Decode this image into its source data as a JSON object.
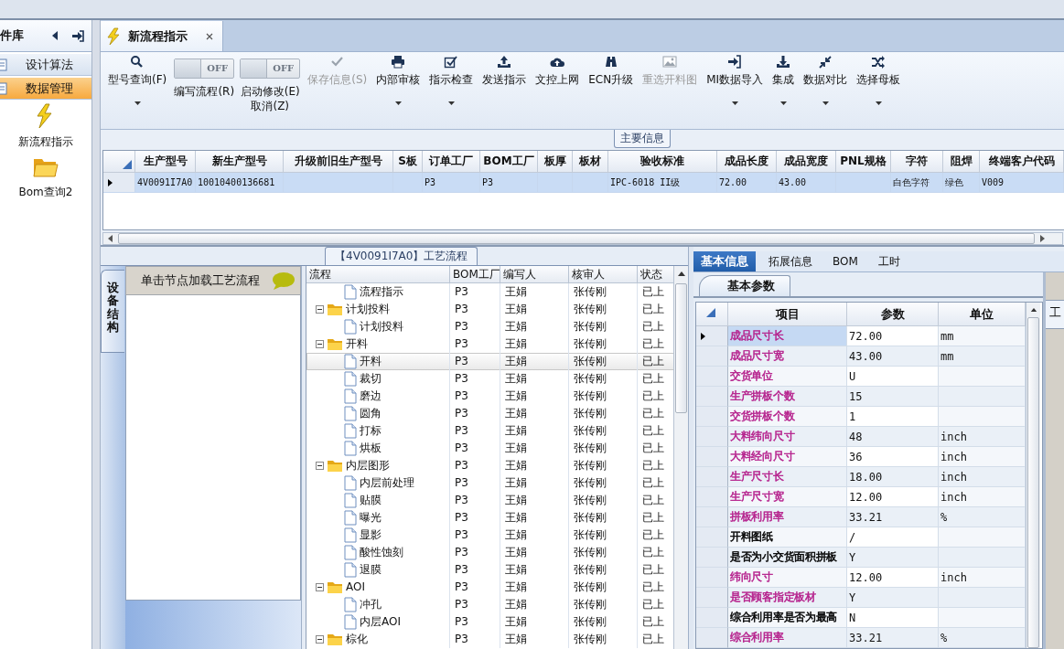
{
  "sidebar": {
    "title": "件库",
    "items": [
      {
        "label": "设计算法",
        "selected": false
      },
      {
        "label": "数据管理",
        "selected": true
      }
    ],
    "shortcuts": [
      {
        "label": "新流程指示"
      },
      {
        "label": "Bom查询2"
      }
    ]
  },
  "tabs": [
    {
      "label": "新流程指示",
      "selected": true,
      "closable": true
    }
  ],
  "toolbar": {
    "items": [
      {
        "kind": "button",
        "label": "型号查询(F)",
        "disabled": false,
        "dropdown": true
      },
      {
        "kind": "toggle",
        "label": "编写流程(R)",
        "on": false,
        "state_text": "OFF"
      },
      {
        "kind": "toggle",
        "label": "启动修改(E)",
        "on": false,
        "state_text": "OFF",
        "sublabel": "取消(Z)"
      },
      {
        "kind": "button",
        "label": "保存信息(S)",
        "disabled": true,
        "dropdown": false
      },
      {
        "kind": "button",
        "label": "内部审核",
        "disabled": false,
        "dropdown": true
      },
      {
        "kind": "button",
        "label": "指示检查",
        "disabled": false,
        "dropdown": true
      },
      {
        "kind": "button",
        "label": "发送指示",
        "disabled": false,
        "dropdown": false
      },
      {
        "kind": "button",
        "label": "文控上网",
        "disabled": false,
        "dropdown": false
      },
      {
        "kind": "button",
        "label": "ECN升级",
        "disabled": false,
        "dropdown": false
      },
      {
        "kind": "button",
        "label": "重选开料图",
        "disabled": true,
        "dropdown": false
      },
      {
        "kind": "button",
        "label": "MI数据导入",
        "disabled": false,
        "dropdown": true
      },
      {
        "kind": "button",
        "label": "集成",
        "disabled": false,
        "dropdown": true
      },
      {
        "kind": "button",
        "label": "数据对比",
        "disabled": false,
        "dropdown": true
      },
      {
        "kind": "button",
        "label": "选择母板",
        "disabled": false,
        "dropdown": true
      }
    ]
  },
  "main_info": {
    "title": "主要信息",
    "columns": [
      "生产型号",
      "新生产型号",
      "升级前旧生产型号",
      "S板",
      "订单工厂",
      "BOM工厂",
      "板厚",
      "板材",
      "验收标准",
      "成品长度",
      "成品宽度",
      "PNL规格",
      "字符",
      "阻焊",
      "终端客户代码"
    ],
    "rows": [
      {
        "selected": true,
        "cells": [
          "4V0091I7A0",
          "10010400136681",
          null,
          null,
          "P3",
          "P3",
          null,
          null,
          "IPC-6018 II级",
          "72.00",
          "43.00",
          null,
          "白色字符",
          "绿色",
          "V009"
        ]
      }
    ]
  },
  "process": {
    "title": "【4V0091I7A0】工艺流程",
    "side_tab": "设备结构",
    "hint": "单击节点加载工艺流程",
    "columns": [
      "流程",
      "BOM工厂",
      "编写人",
      "核审人",
      "状态"
    ],
    "rows": [
      {
        "kind": "step",
        "name": "流程指示",
        "bom": "P3",
        "writer": "王娟",
        "reviewer": "张传刚",
        "status": "已上",
        "selected": false
      },
      {
        "kind": "folder",
        "name": "计划投料",
        "bom": "P3",
        "writer": "王娟",
        "reviewer": "张传刚",
        "status": "已上",
        "selected": false,
        "expanded": true,
        "children": [
          {
            "kind": "step",
            "name": "计划投料",
            "bom": "P3",
            "writer": "王娟",
            "reviewer": "张传刚",
            "status": "已上",
            "selected": false
          }
        ]
      },
      {
        "kind": "folder",
        "name": "开料",
        "bom": "P3",
        "writer": "王娟",
        "reviewer": "张传刚",
        "status": "已上",
        "selected": false,
        "expanded": true,
        "children": [
          {
            "kind": "step",
            "name": "开料",
            "bom": "P3",
            "writer": "王娟",
            "reviewer": "张传刚",
            "status": "已上",
            "selected": true
          },
          {
            "kind": "step",
            "name": "裁切",
            "bom": "P3",
            "writer": "王娟",
            "reviewer": "张传刚",
            "status": "已上",
            "selected": false
          },
          {
            "kind": "step",
            "name": "磨边",
            "bom": "P3",
            "writer": "王娟",
            "reviewer": "张传刚",
            "status": "已上",
            "selected": false
          },
          {
            "kind": "step",
            "name": "圆角",
            "bom": "P3",
            "writer": "王娟",
            "reviewer": "张传刚",
            "status": "已上",
            "selected": false
          },
          {
            "kind": "step",
            "name": "打标",
            "bom": "P3",
            "writer": "王娟",
            "reviewer": "张传刚",
            "status": "已上",
            "selected": false
          },
          {
            "kind": "step",
            "name": "烘板",
            "bom": "P3",
            "writer": "王娟",
            "reviewer": "张传刚",
            "status": "已上",
            "selected": false
          }
        ]
      },
      {
        "kind": "folder",
        "name": "内层图形",
        "bom": "P3",
        "writer": "王娟",
        "reviewer": "张传刚",
        "status": "已上",
        "selected": false,
        "expanded": true,
        "children": [
          {
            "kind": "step",
            "name": "内层前处理",
            "bom": "P3",
            "writer": "王娟",
            "reviewer": "张传刚",
            "status": "已上",
            "selected": false
          },
          {
            "kind": "step",
            "name": "贴膜",
            "bom": "P3",
            "writer": "王娟",
            "reviewer": "张传刚",
            "status": "已上",
            "selected": false
          },
          {
            "kind": "step",
            "name": "曝光",
            "bom": "P3",
            "writer": "王娟",
            "reviewer": "张传刚",
            "status": "已上",
            "selected": false
          },
          {
            "kind": "step",
            "name": "显影",
            "bom": "P3",
            "writer": "王娟",
            "reviewer": "张传刚",
            "status": "已上",
            "selected": false
          },
          {
            "kind": "step",
            "name": "酸性蚀刻",
            "bom": "P3",
            "writer": "王娟",
            "reviewer": "张传刚",
            "status": "已上",
            "selected": false
          },
          {
            "kind": "step",
            "name": "退膜",
            "bom": "P3",
            "writer": "王娟",
            "reviewer": "张传刚",
            "status": "已上",
            "selected": false
          }
        ]
      },
      {
        "kind": "folder",
        "name": "AOI",
        "bom": "P3",
        "writer": "王娟",
        "reviewer": "张传刚",
        "status": "已上",
        "selected": false,
        "expanded": true,
        "children": [
          {
            "kind": "step",
            "name": "冲孔",
            "bom": "P3",
            "writer": "王娟",
            "reviewer": "张传刚",
            "status": "已上",
            "selected": false
          },
          {
            "kind": "step",
            "name": "内层AOI",
            "bom": "P3",
            "writer": "王娟",
            "reviewer": "张传刚",
            "status": "已上",
            "selected": false
          }
        ]
      },
      {
        "kind": "folder",
        "name": "棕化",
        "bom": "P3",
        "writer": "王娟",
        "reviewer": "张传刚",
        "status": "已上",
        "selected": false,
        "expanded": true
      }
    ]
  },
  "details": {
    "tabs": [
      {
        "label": "基本信息",
        "selected": true
      },
      {
        "label": "拓展信息",
        "selected": false
      },
      {
        "label": "BOM",
        "selected": false
      },
      {
        "label": "工时",
        "selected": false
      }
    ],
    "subtab": "基本参数",
    "side_tab": "工",
    "columns": [
      "项目",
      "参数",
      "单位"
    ],
    "rows": [
      {
        "item": "成品尺寸长",
        "value": "72.00",
        "unit": "mm",
        "color": "#b5208c",
        "selected": true
      },
      {
        "item": "成品尺寸宽",
        "value": "43.00",
        "unit": "mm",
        "color": "#b5208c",
        "selected": false
      },
      {
        "item": "交货单位",
        "value": "U",
        "color": "#b5208c",
        "selected": false
      },
      {
        "item": "生产拼板个数",
        "value": "15",
        "color": "#b5208c",
        "selected": false
      },
      {
        "item": "交货拼板个数",
        "value": "1",
        "color": "#b5208c",
        "selected": false
      },
      {
        "item": "大料纬向尺寸",
        "value": "48",
        "unit": "inch",
        "color": "#b5208c",
        "selected": false
      },
      {
        "item": "大料经向尺寸",
        "value": "36",
        "unit": "inch",
        "color": "#b5208c",
        "selected": false
      },
      {
        "item": "生产尺寸长",
        "value": "18.00",
        "unit": "inch",
        "color": "#b5208c",
        "selected": false
      },
      {
        "item": "生产尺寸宽",
        "value": "12.00",
        "unit": "inch",
        "color": "#b5208c",
        "selected": false
      },
      {
        "item": "拼板利用率",
        "value": "33.21",
        "unit": "%",
        "color": "#b5208c",
        "selected": false
      },
      {
        "item": "开料图纸",
        "value": "/",
        "color": "#000000",
        "selected": false
      },
      {
        "item": "是否为小交货面积拼板",
        "value": "Y",
        "color": "#000000",
        "selected": false
      },
      {
        "item": "纬向尺寸",
        "value": "12.00",
        "unit": "inch",
        "color": "#b5208c",
        "selected": false
      },
      {
        "item": "是否顾客指定板材",
        "value": "Y",
        "color": "#b5208c",
        "selected": false
      },
      {
        "item": "综合利用率是否为最高",
        "value": "N",
        "color": "#000000",
        "selected": false
      },
      {
        "item": "综合利用率",
        "value": "33.21",
        "unit": "%",
        "color": "#b5208c",
        "selected": false
      }
    ]
  }
}
